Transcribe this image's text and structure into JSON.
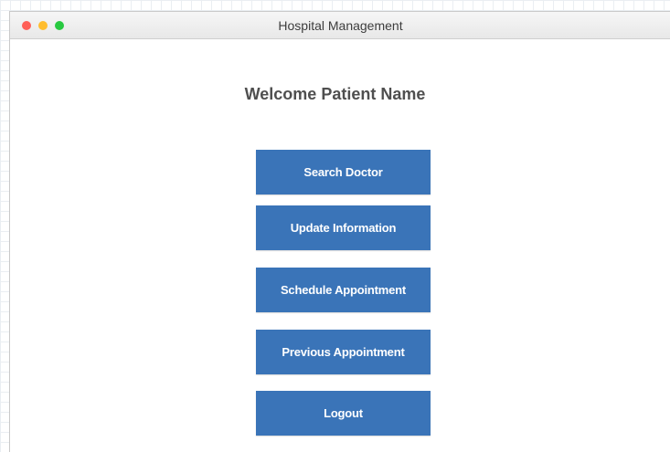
{
  "window": {
    "title": "Hospital Management",
    "controls": {
      "close_color": "#ff5f57",
      "minimize_color": "#ffbd2e",
      "maximize_color": "#28c940"
    }
  },
  "main": {
    "welcome_text": "Welcome Patient Name",
    "buttons": [
      {
        "label": "Search Doctor"
      },
      {
        "label": "Update Information"
      },
      {
        "label": "Schedule Appointment"
      },
      {
        "label": "Previous Appointment"
      },
      {
        "label": "Logout"
      }
    ]
  },
  "colors": {
    "button_bg": "#3a74b8",
    "button_text": "#ffffff"
  }
}
